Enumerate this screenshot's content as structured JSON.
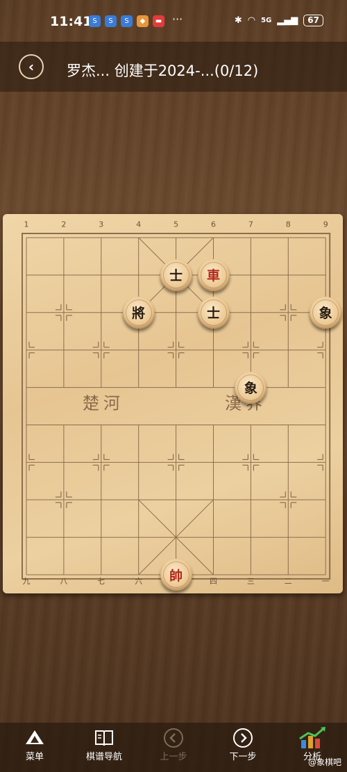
{
  "status_bar": {
    "time": "11:41",
    "more": "···",
    "network": "5G",
    "battery": "67"
  },
  "header": {
    "title": "罗杰... 创建于2024-...(0/12)"
  },
  "board": {
    "top_coords": [
      "1",
      "2",
      "3",
      "4",
      "5",
      "6",
      "7",
      "8",
      "9"
    ],
    "bottom_coords": [
      "九",
      "八",
      "七",
      "六",
      "五",
      "四",
      "三",
      "二",
      "一"
    ],
    "river_left": "楚河",
    "river_right": "漢界",
    "pieces": [
      {
        "char": "士",
        "color": "black",
        "file": 5,
        "rank": 1
      },
      {
        "char": "車",
        "color": "red",
        "file": 6,
        "rank": 1
      },
      {
        "char": "將",
        "color": "black",
        "file": 4,
        "rank": 2
      },
      {
        "char": "士",
        "color": "black",
        "file": 6,
        "rank": 2
      },
      {
        "char": "象",
        "color": "black",
        "file": 9,
        "rank": 2
      },
      {
        "char": "象",
        "color": "black",
        "file": 7,
        "rank": 4
      },
      {
        "char": "帥",
        "color": "red",
        "file": 5,
        "rank": 9
      }
    ]
  },
  "toolbar": {
    "menu_label": "菜单",
    "nav_label": "棋谱导航",
    "prev_label": "上一步",
    "next_label": "下一步",
    "analysis_label": "分析"
  },
  "watermark": "@象棋吧",
  "colors": {
    "red_piece": "#b0271a",
    "black_piece": "#2a1c10",
    "board": "#e8c996"
  }
}
